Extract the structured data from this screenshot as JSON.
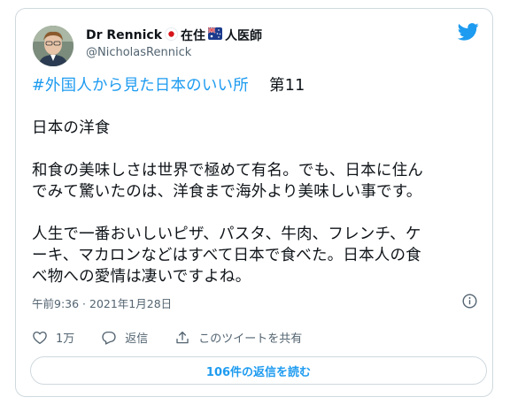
{
  "author": {
    "display_name": "Dr Rennick",
    "name_suffix_before": "在住",
    "name_suffix_after": "人医師",
    "handle": "@NicholasRennick"
  },
  "icons": {
    "japan_flag": "japan-flag-icon",
    "australia_flag": "australia-flag-icon",
    "brand": "twitter-bird-icon",
    "info": "info-icon",
    "like": "heart-icon",
    "reply": "reply-bubble-icon",
    "share": "share-icon"
  },
  "colors": {
    "accent": "#1d9bf0",
    "text": "#0f1419",
    "secondary": "#536471",
    "border": "#cfd9de"
  },
  "tweet": {
    "hashtag": "#外国人から見た日本のいい所",
    "hashtag_suffix": "第11",
    "para1": "日本の洋食",
    "para2_line1": "和食の美味しさは世界で極めて有名。でも、日本に住ん",
    "para2_line2": "でみて驚いたのは、洋食まで海外より美味しい事です。",
    "para3_line1": "人生で一番おいしいピザ、パスタ、牛肉、フレンチ、ケ",
    "para3_line2": "ーキ、マカロンなどはすべて日本で食べた。日本人の食",
    "para3_line3": "べ物への愛情は凄いですよね。"
  },
  "meta": {
    "timestamp": "午前9:36 · 2021年1月28日"
  },
  "actions": {
    "like_count": "1万",
    "reply_label": "返信",
    "share_label": "このツイートを共有"
  },
  "footer": {
    "read_replies_label": "106件の返信を読む"
  }
}
